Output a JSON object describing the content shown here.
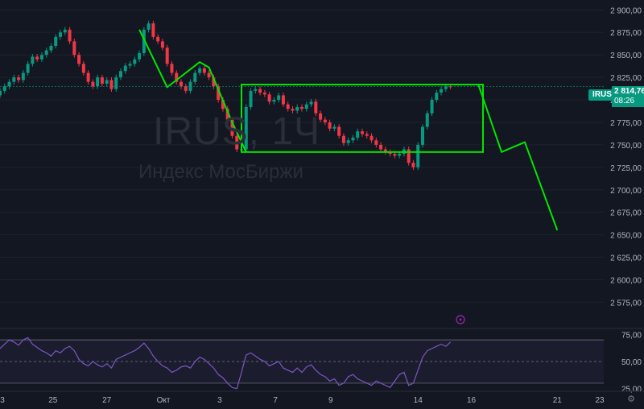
{
  "watermark": {
    "title": "IRUS, 1Ч",
    "subtitle": "Индекс МосБиржи"
  },
  "price_tag": {
    "symbol": "IRUS",
    "price": "2 814,76",
    "countdown": "08:26"
  },
  "chart_data": {
    "type": "line",
    "title": "",
    "xlabel": "",
    "ylabel": "",
    "price_axis": {
      "ylim": [
        2553,
        2911
      ],
      "ticks": [
        "2 900,00",
        "2 875,00",
        "2 850,00",
        "2 825,00",
        "2 800,00",
        "2 775,00",
        "2 750,00",
        "2 725,00",
        "2 700,00",
        "2 675,00",
        "2 650,00",
        "2 625,00",
        "2 600,00",
        "2 575,00"
      ],
      "tick_values": [
        2900,
        2875,
        2850,
        2825,
        2800,
        2775,
        2750,
        2725,
        2700,
        2675,
        2650,
        2625,
        2600,
        2575
      ]
    },
    "time_axis": {
      "xlim": [
        0,
        130
      ],
      "labels": [
        "3",
        "25",
        "27",
        "Окт",
        "3",
        "7",
        "9",
        "14",
        "16",
        "21",
        "23"
      ],
      "label_x": [
        0,
        11.4,
        23.0,
        35.2,
        47.3,
        59.3,
        71.2,
        90.0,
        101.5,
        120.0,
        131.7
      ]
    },
    "candles_close": [
      2810,
      2815,
      2820,
      2825,
      2822,
      2830,
      2840,
      2848,
      2845,
      2850,
      2855,
      2860,
      2870,
      2875,
      2878,
      2865,
      2850,
      2840,
      2830,
      2820,
      2815,
      2825,
      2818,
      2822,
      2812,
      2825,
      2832,
      2838,
      2840,
      2845,
      2852,
      2878,
      2885,
      2870,
      2865,
      2858,
      2840,
      2830,
      2820,
      2815,
      2810,
      2820,
      2830,
      2835,
      2830,
      2825,
      2815,
      2800,
      2790,
      2778,
      2760,
      2745,
      2745,
      2792,
      2810,
      2812,
      2808,
      2806,
      2798,
      2800,
      2805,
      2795,
      2790,
      2788,
      2792,
      2790,
      2795,
      2798,
      2785,
      2778,
      2775,
      2768,
      2770,
      2760,
      2752,
      2755,
      2758,
      2765,
      2762,
      2760,
      2755,
      2750,
      2745,
      2742,
      2740,
      2738,
      2740,
      2745,
      2730,
      2725,
      2750,
      2770,
      2785,
      2800,
      2808,
      2812,
      2815,
      2814.76
    ],
    "current_price": 2814.76,
    "drawings": {
      "rectangle": {
        "x": [
          52,
          104
        ],
        "y": [
          2742,
          2817
        ]
      },
      "path_left": {
        "x": [
          30,
          36,
          43,
          45,
          50,
          53
        ],
        "y": [
          2878,
          2814,
          2842,
          2836,
          2775,
          2742
        ]
      },
      "path_right": {
        "x": [
          103,
          108,
          113,
          120
        ],
        "y": [
          2817,
          2742,
          2753,
          2655
        ]
      }
    },
    "rsi": {
      "ylim": [
        24,
        79
      ],
      "ticks": [
        "75,00",
        "50,00",
        "25,00"
      ],
      "tick_values": [
        75,
        50,
        25
      ],
      "band": [
        70,
        30
      ],
      "values": [
        62,
        66,
        70,
        68,
        65,
        70,
        72,
        66,
        63,
        60,
        58,
        55,
        60,
        58,
        62,
        64,
        60,
        52,
        48,
        46,
        50,
        47,
        45,
        48,
        44,
        52,
        54,
        56,
        58,
        60,
        63,
        67,
        62,
        55,
        50,
        46,
        44,
        40,
        42,
        45,
        46,
        44,
        50,
        54,
        52,
        48,
        44,
        38,
        35,
        30,
        26,
        25,
        40,
        56,
        58,
        55,
        52,
        50,
        46,
        48,
        50,
        44,
        42,
        40,
        44,
        40,
        45,
        47,
        42,
        38,
        36,
        32,
        34,
        28,
        30,
        36,
        38,
        34,
        32,
        30,
        28,
        32,
        30,
        28,
        26,
        32,
        38,
        40,
        28,
        30,
        42,
        54,
        60,
        62,
        64,
        66,
        64,
        68
      ]
    }
  }
}
